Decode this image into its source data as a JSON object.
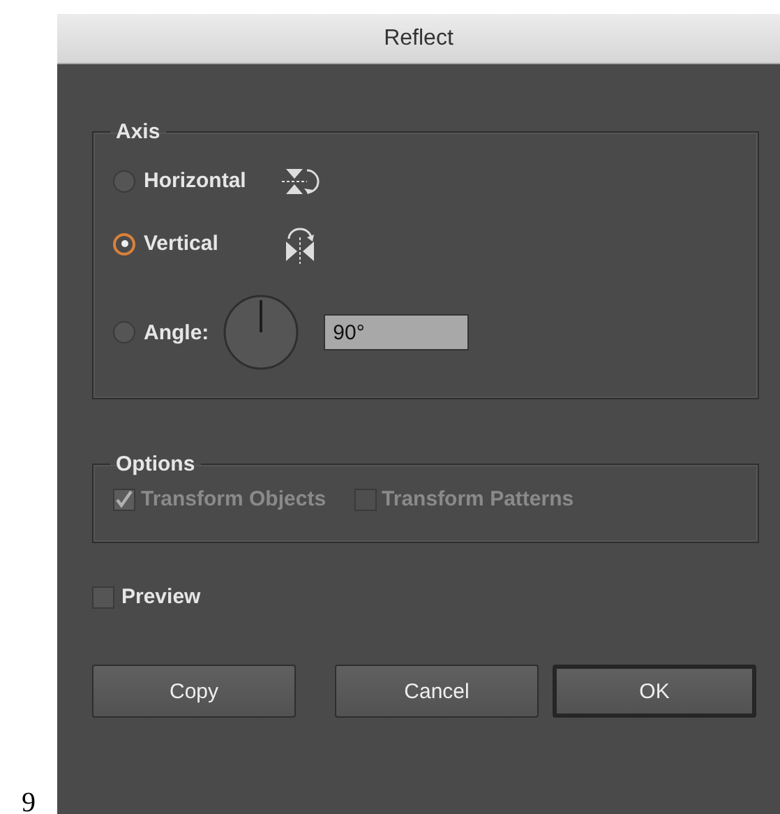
{
  "page_number": "9",
  "window": {
    "title": "Reflect"
  },
  "axis": {
    "title": "Axis",
    "options": [
      {
        "label": "Horizontal",
        "selected": false,
        "kind": "horizontal"
      },
      {
        "label": "Vertical",
        "selected": true,
        "kind": "vertical"
      },
      {
        "label": "Angle:",
        "selected": false,
        "kind": "angle",
        "value": "90°"
      }
    ]
  },
  "options": {
    "title": "Options",
    "checkboxes": [
      {
        "label": "Transform Objects",
        "checked": true,
        "disabled": true
      },
      {
        "label": "Transform Patterns",
        "checked": false,
        "disabled": true
      }
    ]
  },
  "preview": {
    "label": "Preview",
    "checked": false
  },
  "buttons": [
    {
      "label": "Copy",
      "default": false
    },
    {
      "label": "Cancel",
      "default": false
    },
    {
      "label": "OK",
      "default": true
    }
  ]
}
